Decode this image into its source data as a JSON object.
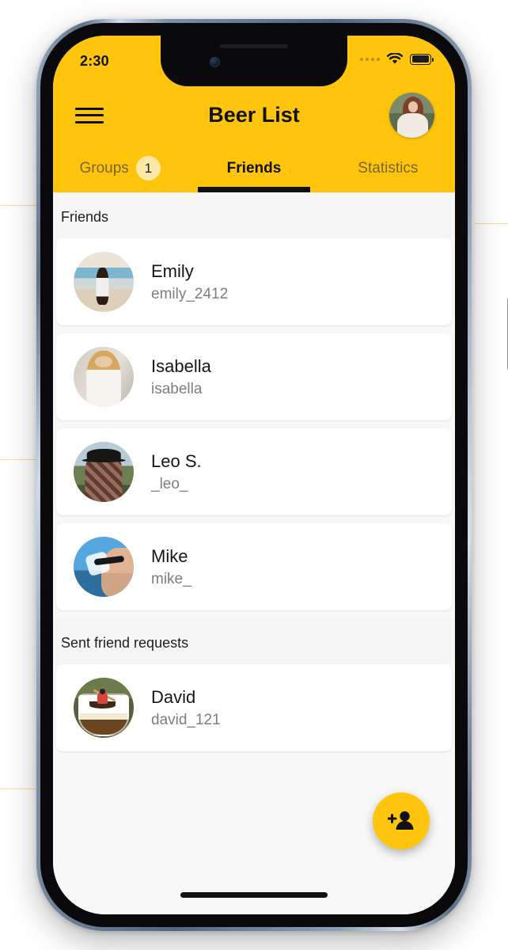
{
  "status_bar": {
    "time": "2:30",
    "signal_icon": "cellular-dots-icon",
    "wifi_icon": "wifi-icon",
    "battery_icon": "battery-full-icon"
  },
  "app_bar": {
    "menu_icon": "hamburger-menu-icon",
    "title": "Beer List",
    "avatar_icon": "user-avatar"
  },
  "tabs": [
    {
      "label": "Groups",
      "active": false,
      "badge": "1"
    },
    {
      "label": "Friends",
      "active": true,
      "badge": ""
    },
    {
      "label": "Statistics",
      "active": false,
      "badge": ""
    }
  ],
  "sections": [
    {
      "header": "Friends",
      "rows": [
        {
          "name": "Emily",
          "username": "emily_2412",
          "avatar": "a-emily"
        },
        {
          "name": "Isabella",
          "username": "isabella",
          "avatar": "a-isa"
        },
        {
          "name": "Leo S.",
          "username": "_leo_",
          "avatar": "a-leo"
        },
        {
          "name": "Mike",
          "username": "mike_",
          "avatar": "a-mike"
        }
      ]
    },
    {
      "header": "Sent friend requests",
      "rows": [
        {
          "name": "David",
          "username": "david_121",
          "avatar": "a-dav"
        }
      ]
    }
  ],
  "fab": {
    "icon": "person-add-icon",
    "label": "Add friend"
  },
  "colors": {
    "accent_yellow": "#ffc40c",
    "badge_bg": "#fce9a8",
    "tab_inactive": "#7a6528",
    "card_bg": "#ffffff",
    "content_bg": "#f8f8f8",
    "primary_text": "#161616",
    "secondary_text": "#7d7d7d"
  }
}
